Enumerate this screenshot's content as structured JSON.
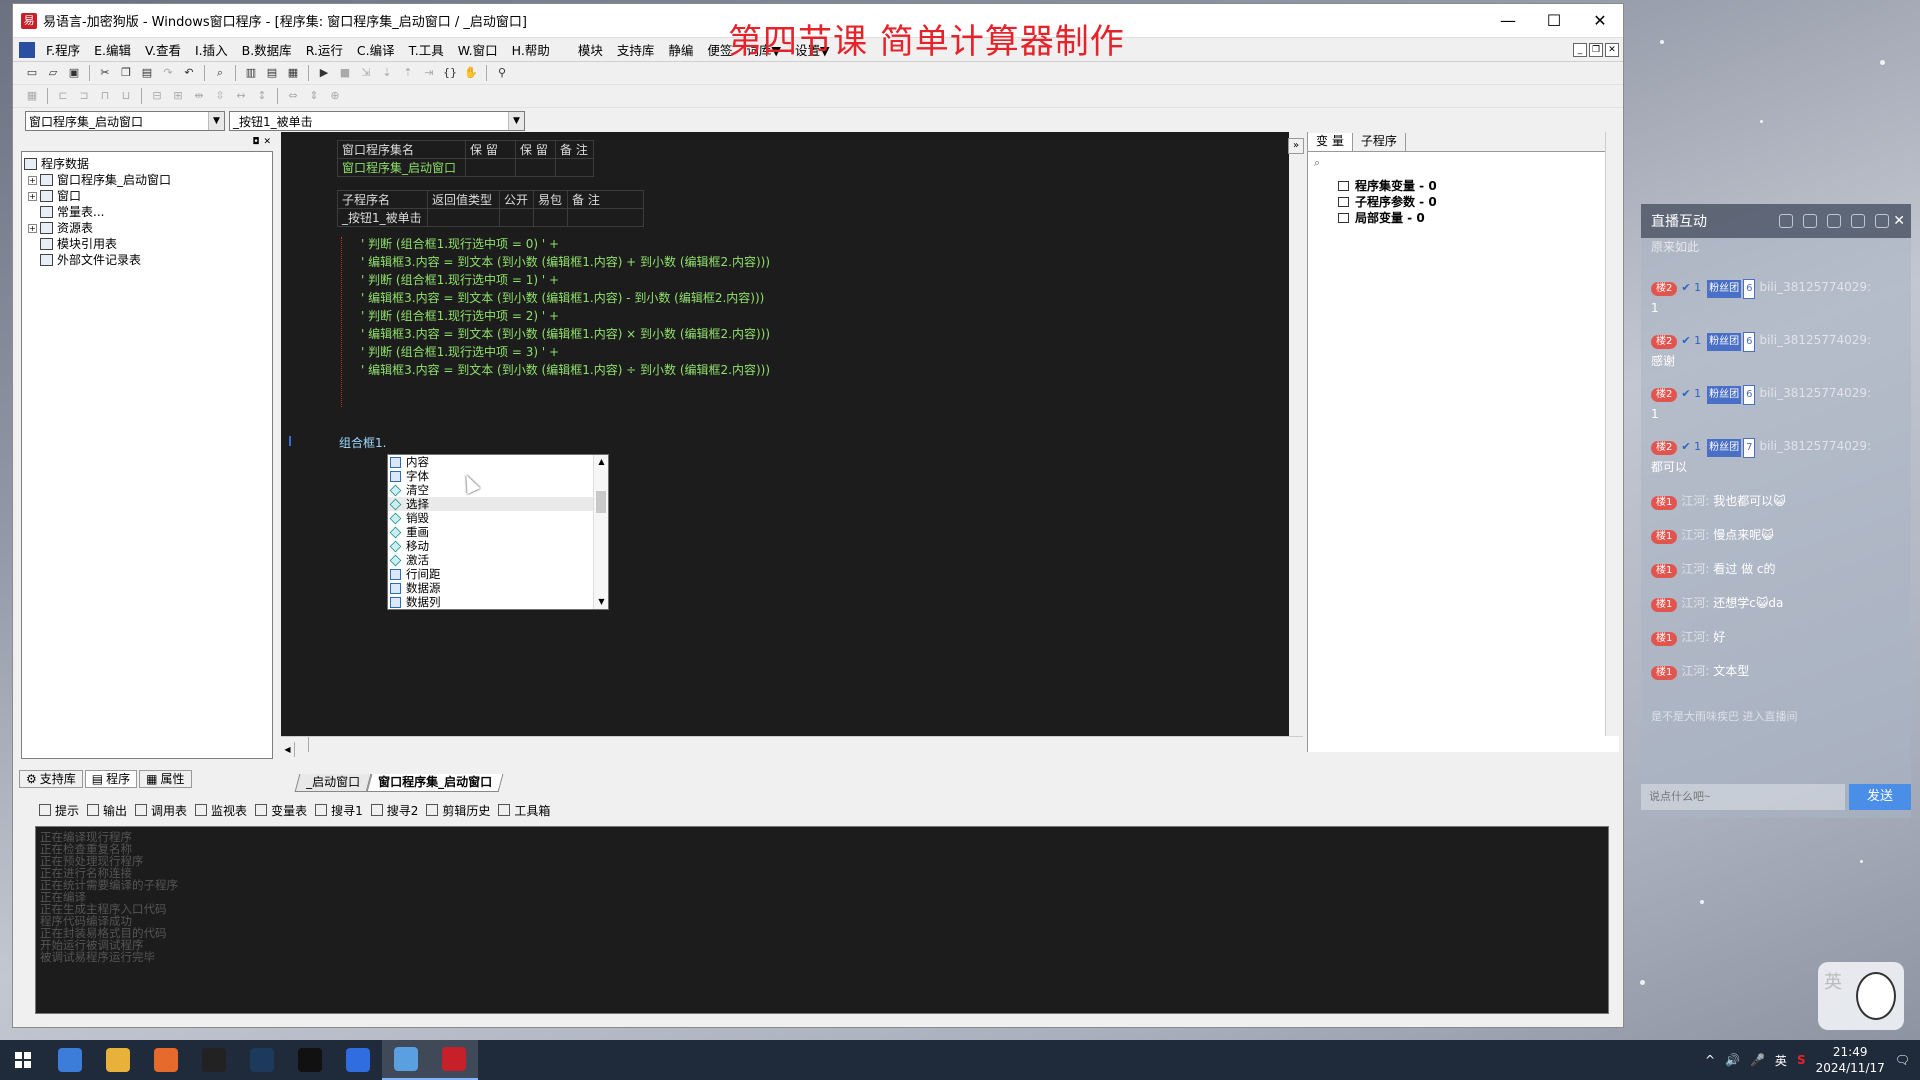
{
  "window": {
    "title": "易语言-加密狗版 - Windows窗口程序 - [程序集: 窗口程序集_启动窗口 / _启动窗口]",
    "controls": [
      "—",
      "☐",
      "✕"
    ]
  },
  "overlay_title": "第四节课 简单计算器制作",
  "menu": [
    "F.程序",
    "E.编辑",
    "V.查看",
    "I.插入",
    "B.数据库",
    "R.运行",
    "C.编译",
    "T.工具",
    "W.窗口",
    "H.帮助",
    "模块",
    "支持库",
    "静编",
    "便签",
    "词库▼",
    "设置▼"
  ],
  "combos": {
    "left": "窗口程序集_启动窗口",
    "right": "_按钮1_被单击"
  },
  "tree": [
    {
      "label": "程序数据",
      "exp": ""
    },
    {
      "label": "窗口程序集_启动窗口",
      "exp": "+"
    },
    {
      "label": "窗口",
      "exp": "+"
    },
    {
      "label": "常量表...",
      "exp": ""
    },
    {
      "label": "资源表",
      "exp": "+"
    },
    {
      "label": "模块引用表",
      "exp": ""
    },
    {
      "label": "外部文件记录表",
      "exp": ""
    }
  ],
  "left_tabs": [
    "支持库",
    "程序",
    "属性"
  ],
  "assembly_table": {
    "headers": [
      "窗口程序集名",
      "保 留",
      "保 留",
      "备 注"
    ],
    "row": [
      "窗口程序集_启动窗口",
      "",
      "",
      ""
    ]
  },
  "sub_table": {
    "headers": [
      "子程序名",
      "返回值类型",
      "公开",
      "易包",
      "备 注"
    ],
    "row": [
      "_按钮1_被单击",
      "",
      "",
      "",
      ""
    ]
  },
  "code_lines": [
    "' 判断 (组合框1.现行选中项 = 0) ' +",
    "' 编辑框3.内容 = 到文本 (到小数 (编辑框1.内容) + 到小数 (编辑框2.内容)))",
    "' 判断 (组合框1.现行选中项 = 1) ' +",
    "' 编辑框3.内容 = 到文本 (到小数 (编辑框1.内容) - 到小数 (编辑框2.内容)))",
    "' 判断 (组合框1.现行选中项 = 2) ' +",
    "' 编辑框3.内容 = 到文本 (到小数 (编辑框1.内容) × 到小数 (编辑框2.内容)))",
    "' 判断 (组合框1.现行选中项 = 3) ' +",
    "' 编辑框3.内容 = 到文本 (到小数 (编辑框1.内容) ÷ 到小数 (编辑框2.内容)))"
  ],
  "typed_text": "组合框1.",
  "autocomplete": [
    {
      "label": "内容",
      "kind": "prop"
    },
    {
      "label": "字体",
      "kind": "prop"
    },
    {
      "label": "清空",
      "kind": "method"
    },
    {
      "label": "选择",
      "kind": "method"
    },
    {
      "label": "销毁",
      "kind": "method"
    },
    {
      "label": "重画",
      "kind": "method"
    },
    {
      "label": "移动",
      "kind": "method"
    },
    {
      "label": "激活",
      "kind": "method"
    },
    {
      "label": "行间距",
      "kind": "prop"
    },
    {
      "label": "数据源",
      "kind": "prop"
    },
    {
      "label": "数据列",
      "kind": "prop"
    }
  ],
  "right_panel": {
    "tabs": [
      "变 量",
      "子程序"
    ],
    "vars": [
      "程序集变量 - 0",
      "子程序参数 - 0",
      "局部变量 - 0"
    ]
  },
  "editor_tabs": [
    "_启动窗口",
    "窗口程序集_启动窗口"
  ],
  "output_tabs": [
    "提示",
    "输出",
    "调用表",
    "监视表",
    "变量表",
    "搜寻1",
    "搜寻2",
    "剪辑历史",
    "工具箱"
  ],
  "output_lines": [
    "正在编译现行程序",
    "正在检查重复名称",
    "正在预处理现行程序",
    "正在进行名称连接",
    "正在统计需要编译的子程序",
    "正在编译",
    "正在生成主程序入口代码",
    "程序代码编译成功",
    "正在封装易格式目的代码",
    "开始运行被调试程序",
    "被调试易程序运行完毕"
  ],
  "chat": {
    "title": "直播互动",
    "top_text": "原来如此",
    "messages": [
      {
        "badge": "楼2",
        "v": "1",
        "fan": "粉丝团",
        "lvl": "6",
        "user": "bili_38125774029:",
        "text": "1"
      },
      {
        "badge": "楼2",
        "v": "1",
        "fan": "粉丝团",
        "lvl": "6",
        "user": "bili_38125774029:",
        "text": "感谢"
      },
      {
        "badge": "楼2",
        "v": "1",
        "fan": "粉丝团",
        "lvl": "6",
        "user": "bili_38125774029:",
        "text": "1"
      },
      {
        "badge": "楼2",
        "v": "1",
        "fan": "粉丝团",
        "lvl": "7",
        "user": "bili_38125774029:",
        "text": "都可以"
      },
      {
        "badge": "楼1",
        "user": "江河:",
        "text": "我也都可以😺"
      },
      {
        "badge": "楼1",
        "user": "江河:",
        "text": "慢点来呢😺"
      },
      {
        "badge": "楼1",
        "user": "江河:",
        "text": "看过 做 c的"
      },
      {
        "badge": "楼1",
        "user": "江河:",
        "text": "还想学c😺da"
      },
      {
        "badge": "楼1",
        "user": "江河:",
        "text": "好"
      },
      {
        "badge": "楼1",
        "user": "江河:",
        "text": "文本型"
      }
    ],
    "notice": "是不是大雨味疾巴 进入直播间",
    "input_placeholder": "说点什么吧~",
    "send": "发送"
  },
  "ime": {
    "text": "英"
  },
  "taskbar": {
    "apps": [
      {
        "name": "computer-icon",
        "color": "#3b7dd8"
      },
      {
        "name": "folder-icon",
        "color": "#e8b23a"
      },
      {
        "name": "firefox-icon",
        "color": "#e66a2c"
      },
      {
        "name": "qq-icon",
        "color": "#222222"
      },
      {
        "name": "steam-icon",
        "color": "#1b3a5c"
      },
      {
        "name": "tiktok-icon",
        "color": "#111111"
      },
      {
        "name": "browser-icon",
        "color": "#2f6de0"
      },
      {
        "name": "tool-icon",
        "color": "#5aa0e0"
      },
      {
        "name": "easylang-icon",
        "color": "#c8202a"
      }
    ],
    "tray": [
      "^",
      "🔊",
      "🎤",
      "英",
      "S"
    ],
    "time": "21:49",
    "date": "2024/11/17"
  }
}
